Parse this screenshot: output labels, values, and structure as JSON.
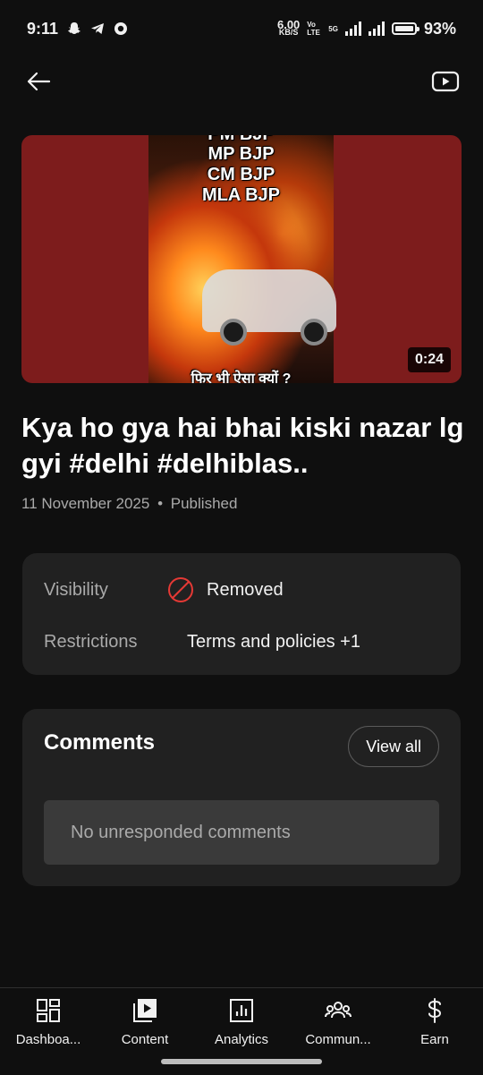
{
  "status_bar": {
    "time": "9:11",
    "net_speed": "6.00",
    "net_unit": "KB/S",
    "volte": "Vo LTE",
    "network": "5G",
    "battery": "93%"
  },
  "video": {
    "overlay_lines": [
      "PM BJP",
      "MP BJP",
      "CM BJP",
      "MLA BJP"
    ],
    "bottom_caption": "फिर भी ऐसा क्यों ?",
    "duration": "0:24",
    "title": "Kya ho gya hai bhai kiski nazar lg gyi #delhi #delhiblas..",
    "date": "11 November 2025",
    "separator": "•",
    "status": "Published"
  },
  "details": {
    "visibility_label": "Visibility",
    "visibility_value": "Removed",
    "restrictions_label": "Restrictions",
    "restrictions_value": "Terms and policies +1"
  },
  "comments": {
    "title": "Comments",
    "view_all": "View all",
    "empty_text": "No unresponded comments"
  },
  "nav": {
    "items": [
      {
        "label": "Dashboa...",
        "icon": "dashboard-icon"
      },
      {
        "label": "Content",
        "icon": "content-icon"
      },
      {
        "label": "Analytics",
        "icon": "analytics-icon"
      },
      {
        "label": "Commun...",
        "icon": "community-icon"
      },
      {
        "label": "Earn",
        "icon": "earn-icon"
      }
    ]
  },
  "colors": {
    "background": "#0f0f0f",
    "card": "#212121",
    "removed": "#e53935",
    "muted_text": "#aaaaaa"
  }
}
